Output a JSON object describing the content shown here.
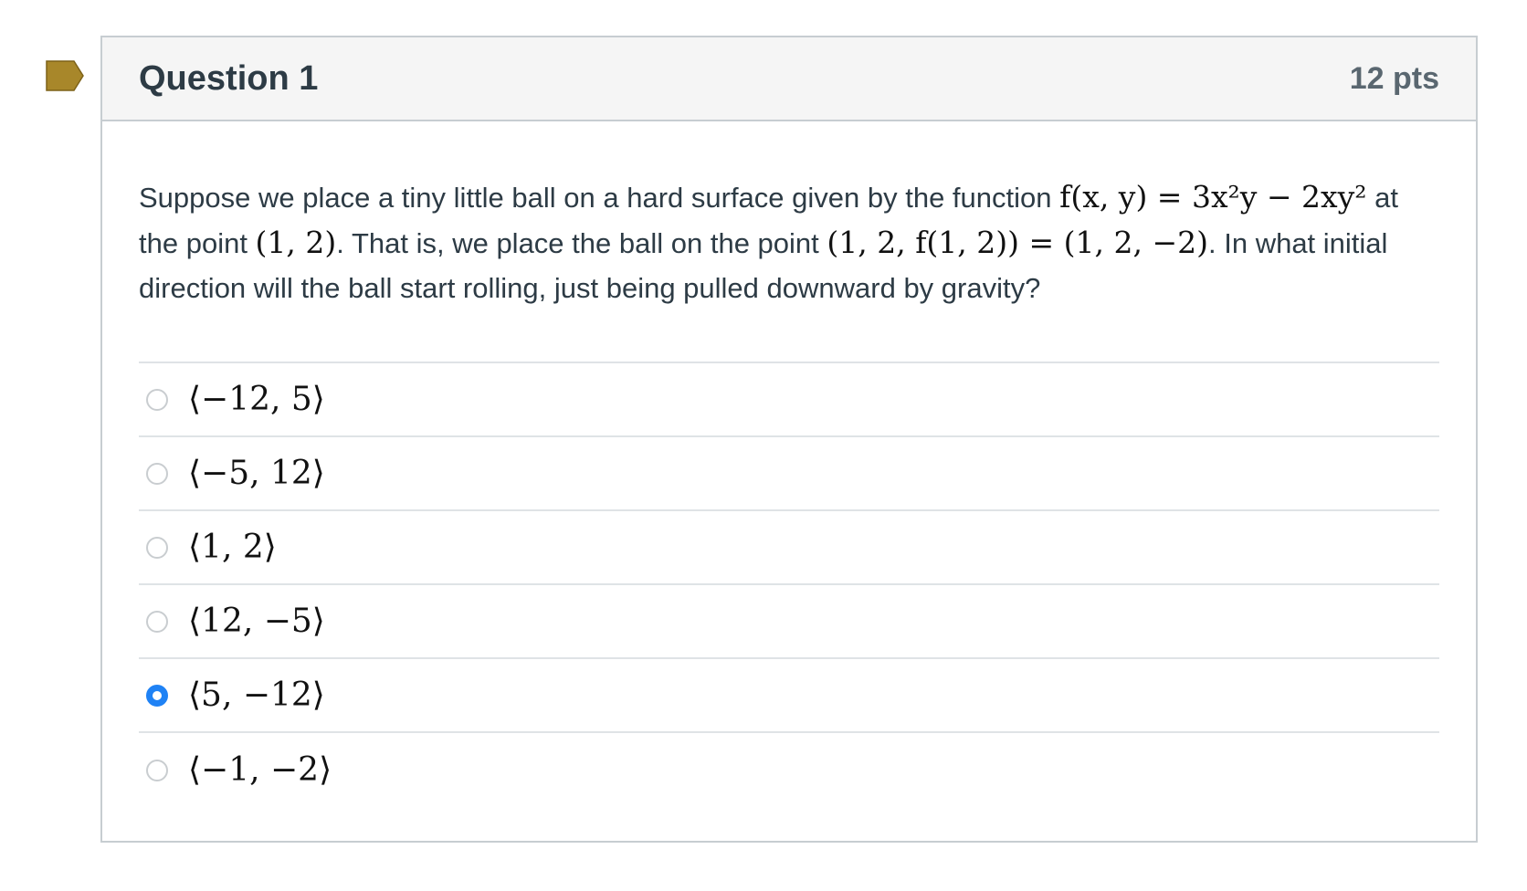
{
  "question": {
    "title": "Question 1",
    "points": "12 pts",
    "text_part1": "Suppose we place a tiny little ball on a hard surface given by the function ",
    "math_function": "f(x, y) = 3x²y − 2xy²",
    "text_part2": " at the point ",
    "math_point": "(1, 2)",
    "text_part3": ". That is, we place the ball on the point ",
    "math_point3d": "(1, 2, f(1, 2)) = (1, 2, −2)",
    "text_part4": ". In what initial direction will the ball start rolling, just being pulled downward by gravity?"
  },
  "answers": [
    {
      "label": "⟨−12, 5⟩",
      "selected": false
    },
    {
      "label": "⟨−5, 12⟩",
      "selected": false
    },
    {
      "label": "⟨1, 2⟩",
      "selected": false
    },
    {
      "label": "⟨12, −5⟩",
      "selected": false
    },
    {
      "label": "⟨5, −12⟩",
      "selected": true
    },
    {
      "label": "⟨−1, −2⟩",
      "selected": false
    }
  ],
  "colors": {
    "flag": "#a8872a",
    "selected_radio": "#1f82f5",
    "header_bg": "#f5f5f5",
    "border": "#c7cdd1"
  },
  "icons": {
    "flag": "bookmark-flag-icon"
  }
}
